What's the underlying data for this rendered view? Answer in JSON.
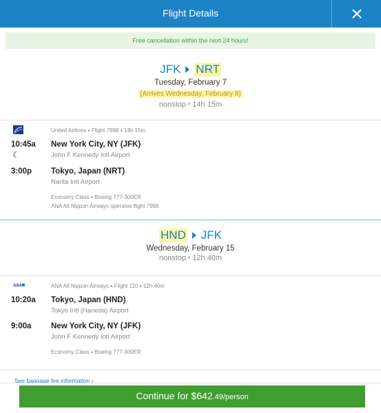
{
  "header": {
    "title": "Flight Details",
    "close_icon": "close-icon"
  },
  "banner": {
    "text": "Free cancellation within the next 24 hours!"
  },
  "outbound": {
    "origin": "JFK",
    "destination": "NRT",
    "date": "Tuesday, February 7",
    "arrives": "(Arrives Wednesday, February 8)",
    "stops": "nonstop",
    "duration": "14h 15m",
    "segment": {
      "airline": "United Airlines",
      "flight": "Flight 7998",
      "duration": "14h 15m",
      "depart_time": "10:45a",
      "depart_city": "New York City, NY (JFK)",
      "depart_airport": "John F Kennedy Intl Airport",
      "arrive_time": "3:00p",
      "arrive_city": "Tokyo, Japan (NRT)",
      "arrive_airport": "Narita Intl Airport",
      "cabin": "Economy Class",
      "aircraft": "Boeing 777-300ER",
      "operated_by": "ANA All Nippon Airways operates flight 7998"
    }
  },
  "return": {
    "origin": "HND",
    "destination": "JFK",
    "date": "Wednesday, February 15",
    "stops": "nonstop",
    "duration": "12h 40m",
    "segment": {
      "airline": "ANA All Nippon Airways",
      "flight": "Flight 110",
      "duration": "12h 40m",
      "depart_time": "10:20a",
      "depart_city": "Tokyo, Japan (HND)",
      "depart_airport": "Tokyo Intl (Haneda) Airport",
      "arrive_time": "9:00a",
      "arrive_city": "New York City, NY (JFK)",
      "arrive_airport": "John F Kennedy Intl Airport",
      "cabin": "Economy Class",
      "aircraft": "Boeing 777-300ER"
    }
  },
  "baggage_link": "See baggage fee information ›",
  "continue": {
    "prefix": "Continue for ",
    "price_main": "$642",
    "price_cents": ".49",
    "per": "/person"
  },
  "colors": {
    "brand_blue": "#1b82c5",
    "button_green": "#3e9e2f",
    "highlight": "#fbf6a4",
    "banner_bg": "#e9f5e4"
  }
}
